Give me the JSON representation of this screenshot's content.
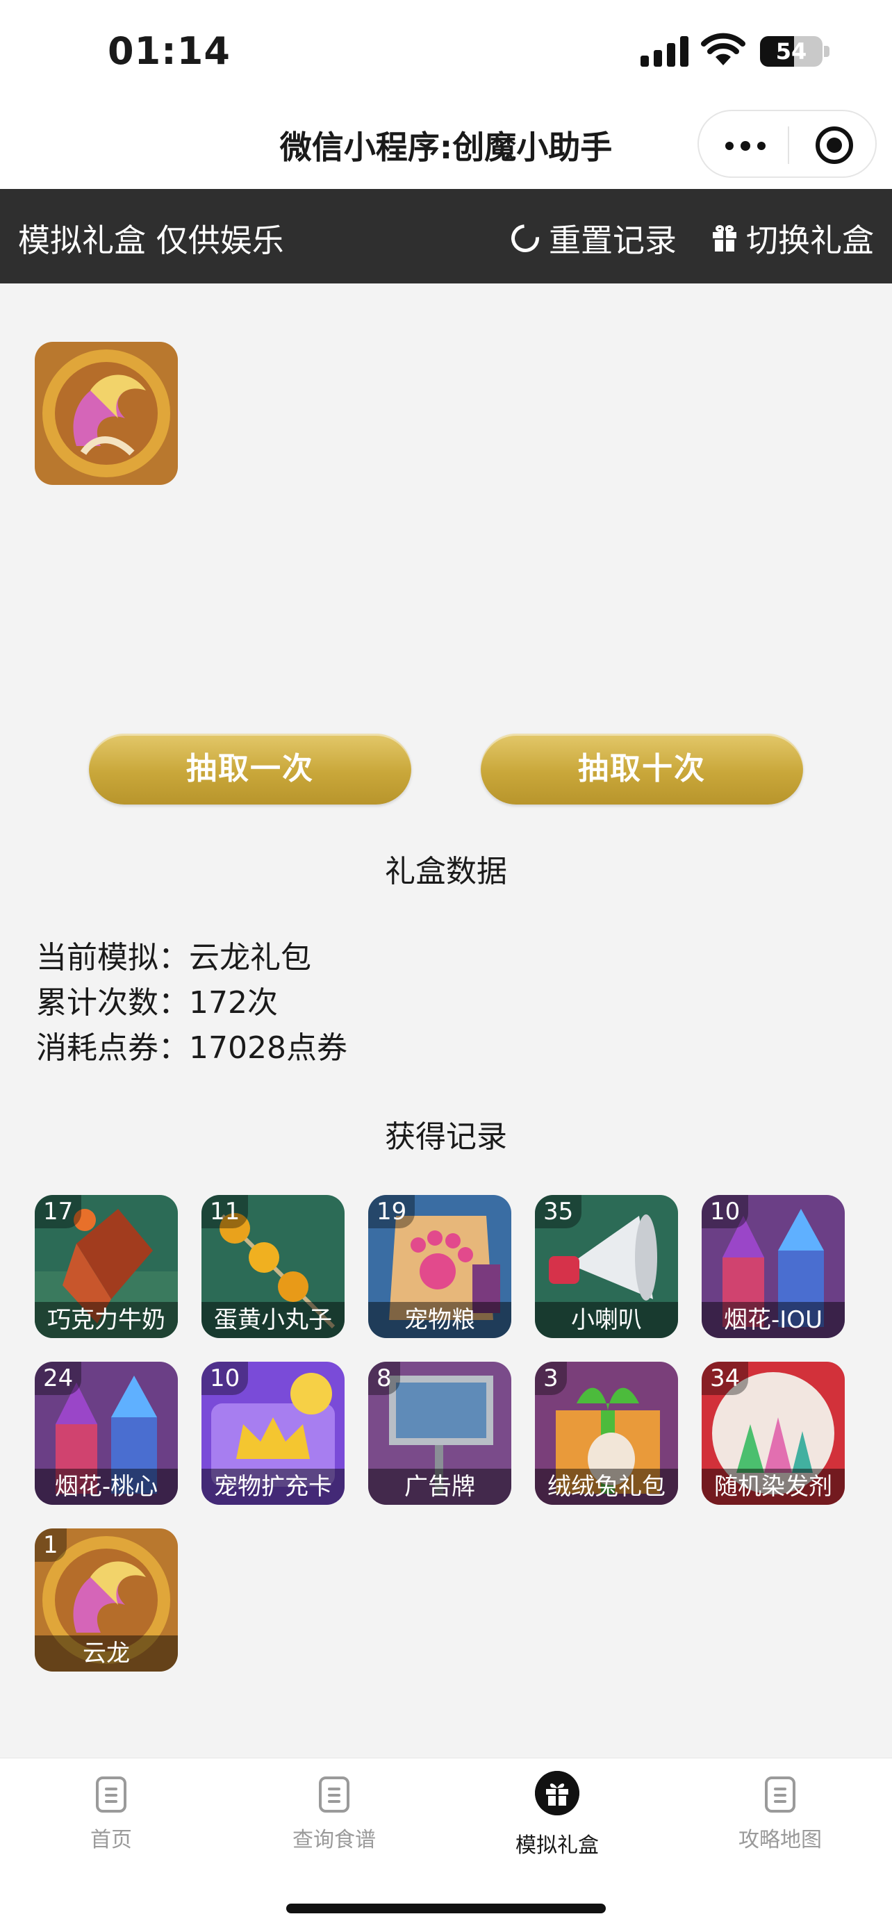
{
  "status_bar": {
    "time": "01:14",
    "battery": "54",
    "battery_fraction": 0.54
  },
  "nav": {
    "title": "微信小程序:创魔小助手",
    "more_icon": "more-icon",
    "close_icon": "target-icon"
  },
  "toolbar": {
    "label": "模拟礼盒 仅供娱乐",
    "reset_label": "重置记录",
    "switch_label": "切换礼盒"
  },
  "current_draw": {
    "item_icon": "cloud-dragon-icon"
  },
  "buttons": {
    "draw_once": "抽取一次",
    "draw_ten": "抽取十次"
  },
  "stats": {
    "title": "礼盒数据",
    "current_label": "当前模拟：",
    "current_value": "云龙礼包",
    "count_label": "累计次数：",
    "count_value": "172次",
    "cost_label": "消耗点券：",
    "cost_value": "17028点券"
  },
  "records": {
    "title": "获得记录",
    "items": [
      {
        "count": "17",
        "name": "巧克力牛奶",
        "icon": "chocolate-milk-icon"
      },
      {
        "count": "11",
        "name": "蛋黄小丸子",
        "icon": "egg-yolk-skewer-icon"
      },
      {
        "count": "19",
        "name": "宠物粮",
        "icon": "pet-food-icon"
      },
      {
        "count": "35",
        "name": "小喇叭",
        "icon": "megaphone-icon"
      },
      {
        "count": "10",
        "name": "烟花-IOU",
        "icon": "firework-icon"
      },
      {
        "count": "24",
        "name": "烟花-桃心",
        "icon": "firework-icon"
      },
      {
        "count": "10",
        "name": "宠物扩充卡",
        "icon": "pet-card-icon"
      },
      {
        "count": "8",
        "name": "广告牌",
        "icon": "billboard-icon"
      },
      {
        "count": "3",
        "name": "绒绒兔礼包",
        "icon": "bunny-gift-icon"
      },
      {
        "count": "34",
        "name": "随机染发剂",
        "icon": "hair-dye-icon"
      },
      {
        "count": "1",
        "name": "云龙",
        "icon": "cloud-dragon-icon"
      }
    ]
  },
  "tabbar": {
    "tabs": [
      {
        "label": "首页",
        "icon": "document-icon"
      },
      {
        "label": "查询食谱",
        "icon": "document-icon"
      },
      {
        "label": "模拟礼盒",
        "icon": "gift-icon"
      },
      {
        "label": "攻略地图",
        "icon": "document-icon"
      }
    ]
  }
}
